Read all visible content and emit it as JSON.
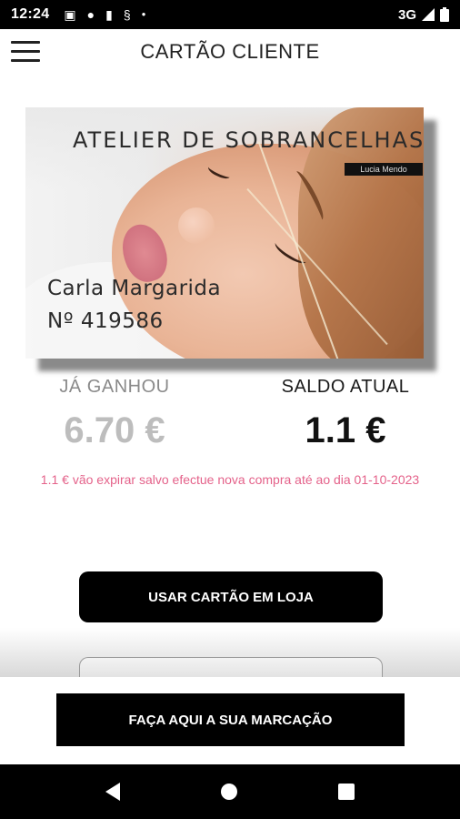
{
  "status_bar": {
    "time": "12:24",
    "network": "3G",
    "icons": [
      "image-icon",
      "chat-icon",
      "sd-card-icon",
      "s-icon",
      "dot-icon",
      "signal-icon",
      "battery-icon"
    ]
  },
  "app_bar": {
    "title": "CARTÃO CLIENTE",
    "menu_icon": "hamburger-menu-icon"
  },
  "card": {
    "brand": "ATELIER DE SOBRANCELHAS",
    "sub_brand": "Lucia Mendo",
    "holder_name": "Carla Margarida",
    "card_number": "Nº 419586"
  },
  "earned": {
    "label": "JÁ GANHOU",
    "value": "6.70 €"
  },
  "balance": {
    "label": "SALDO ATUAL",
    "value": "1.1 €"
  },
  "expiry_note": "1.1 € vão expirar salvo efectue nova compra até ao dia 01-10-2023",
  "buttons": {
    "use_card": "USAR CARTÃO EM LOJA",
    "booking": "FAÇA AQUI A SUA MARCAÇÃO"
  },
  "nav_bar": {
    "icons": [
      "back-icon",
      "home-icon",
      "recent-apps-icon"
    ]
  },
  "colors": {
    "accent_pink": "#e4628a",
    "button_black": "#000000",
    "earned_gray": "#bdbdbd"
  }
}
